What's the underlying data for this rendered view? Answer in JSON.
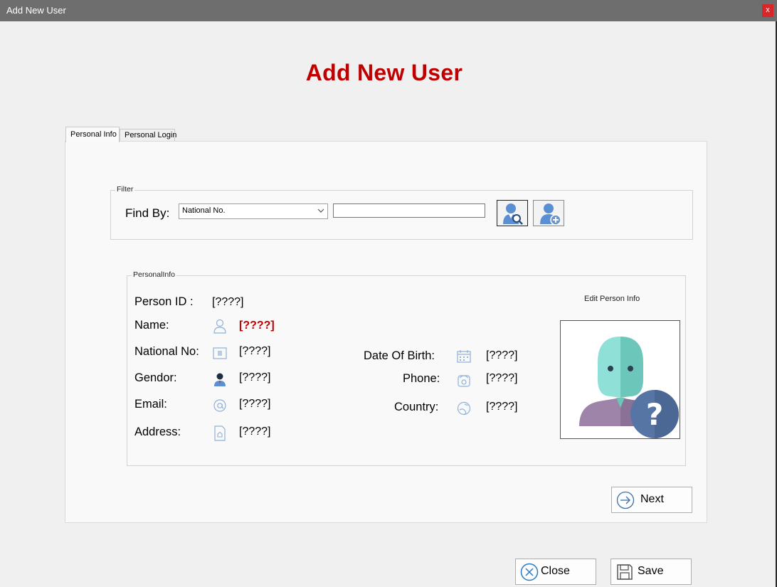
{
  "window": {
    "title": "Add New User",
    "close_label": "x"
  },
  "heading": "Add New User",
  "tabs": [
    {
      "label": "Personal Info",
      "active": true
    },
    {
      "label": "Personal Login",
      "active": false
    }
  ],
  "filter": {
    "legend": "Filter",
    "find_by_label": "Find By:",
    "selected_option": "National No.",
    "search_value": ""
  },
  "personal_info": {
    "legend": "PersonalInfo",
    "edit_link": "Edit Person Info",
    "person_id_label": "Person ID :",
    "person_id_value": "[????]",
    "name_label": "Name:",
    "name_value": "[????]",
    "national_no_label": "National No:",
    "national_no_value": "[????]",
    "gender_label": "Gendor:",
    "gender_value": "[????]",
    "email_label": "Email:",
    "email_value": "[????]",
    "address_label": "Address:",
    "address_value": "[????]",
    "dob_label": "Date Of Birth:",
    "dob_value": "[????]",
    "phone_label": "Phone:",
    "phone_value": "[????]",
    "country_label": "Country:",
    "country_value": "[????]"
  },
  "buttons": {
    "next": "Next",
    "close": "Close",
    "save": "Save"
  },
  "colors": {
    "heading": "#c00000",
    "titlebar": "#6e6e6e",
    "icon_blue": "#5b8fd4"
  }
}
